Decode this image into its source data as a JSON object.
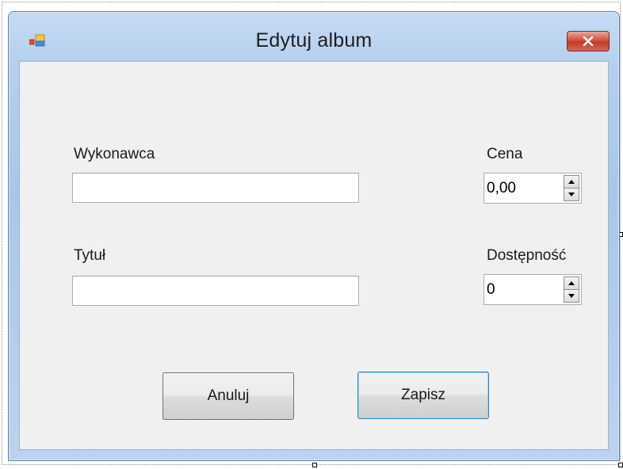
{
  "window": {
    "title": "Edytuj album",
    "close_glyph": "✕",
    "icon": "app-form-icon"
  },
  "form": {
    "artist_label": "Wykonawca",
    "artist_value": "",
    "title_label": "Tytuł",
    "title_value": "",
    "price_label": "Cena",
    "price_value": "0,00",
    "stock_label": "Dostępność",
    "stock_value": "0"
  },
  "buttons": {
    "cancel_label": "Anuluj",
    "save_label": "Zapisz"
  },
  "colors": {
    "client_bg": "#f0f0f0",
    "frame": "#a9c6ea",
    "close_button": "#c23a24",
    "default_button_border": "#3c7fb1"
  }
}
